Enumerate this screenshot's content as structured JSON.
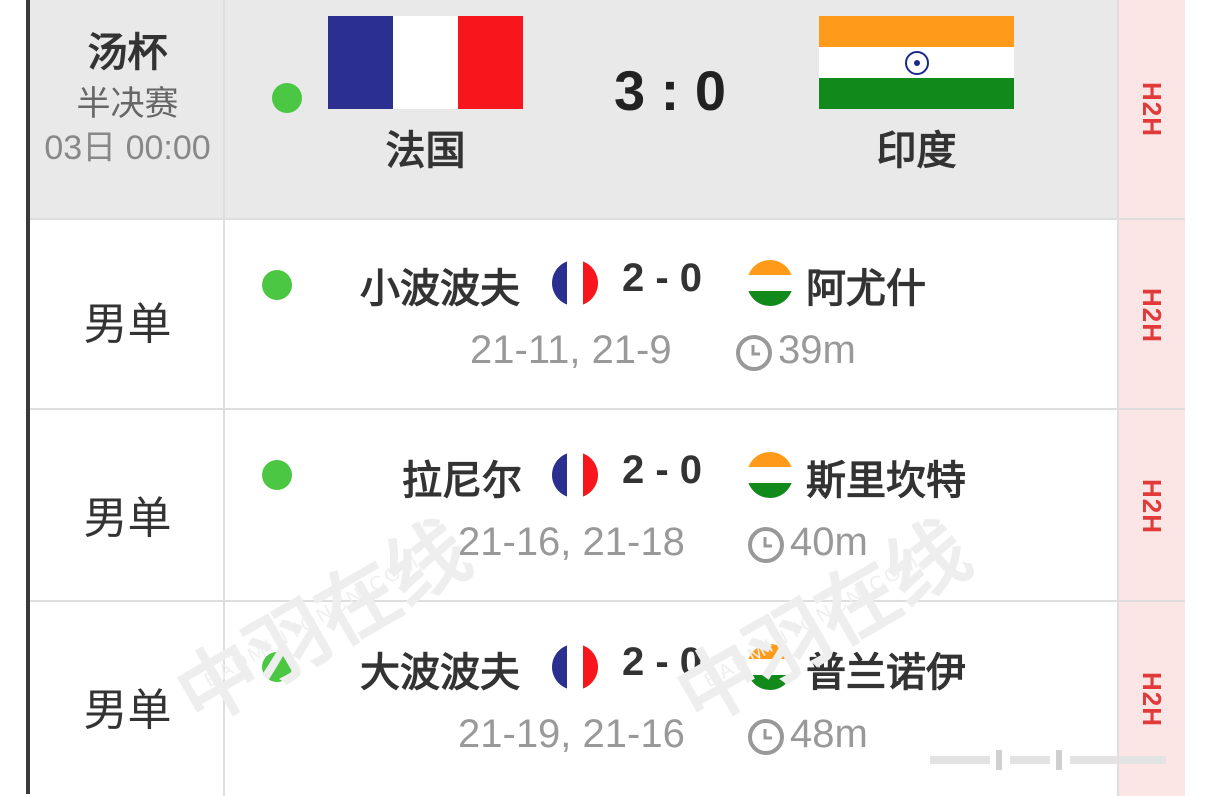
{
  "header": {
    "cup_name": "汤杯",
    "stage": "半决赛",
    "datetime": "03日 00:00",
    "home_team": "法国",
    "away_team": "印度",
    "score": "3 : 0",
    "h2h_label": "H2H",
    "home_flag_colors": [
      "#2b2f8f",
      "#ffffff",
      "#f6161b"
    ],
    "away_flag_colors": [
      "#ff9a1a",
      "#ffffff",
      "#12891b"
    ],
    "status_color": "#4cc744"
  },
  "matches": [
    {
      "event": "男单",
      "home_player": "小波波夫",
      "score": "2 - 0",
      "away_player": "阿尤什",
      "games": "21-11, 21-9",
      "duration": "39m",
      "h2h_label": "H2H"
    },
    {
      "event": "男单",
      "home_player": "拉尼尔",
      "score": "2 - 0",
      "away_player": "斯里坎特",
      "games": "21-16, 21-18",
      "duration": "40m",
      "h2h_label": "H2H"
    },
    {
      "event": "男单",
      "home_player": "大波波夫",
      "score": "2 - 0",
      "away_player": "普兰诺伊",
      "games": "21-19, 21-16",
      "duration": "48m",
      "h2h_label": "H2H"
    }
  ],
  "watermark": {
    "text": "中羽在线",
    "sub": "BADMINTONCN.COM"
  },
  "icons": {
    "clock": "clock-icon",
    "status": "live-status-dot"
  }
}
